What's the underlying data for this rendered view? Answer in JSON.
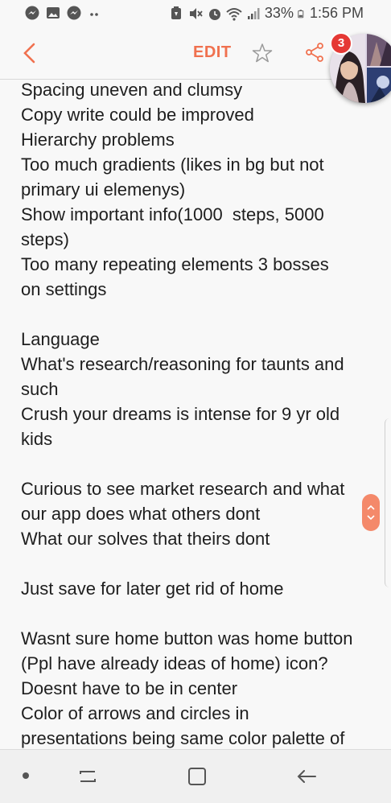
{
  "status_bar": {
    "battery": "33%",
    "time": "1:56 PM"
  },
  "app_bar": {
    "edit_label": "EDIT"
  },
  "chat_head": {
    "badge_count": "3"
  },
  "note": {
    "lines": [
      "Spacing uneven and clumsy",
      "Copy write could be improved",
      "Hierarchy problems",
      "Too much gradients (likes in bg but not",
      "primary ui elemenys)",
      "Show important info(1000  steps, 5000",
      "steps)",
      "Too many repeating elements 3 bosses",
      "on settings",
      "",
      "Language",
      "What's research/reasoning for taunts and",
      "such",
      "Crush your dreams is intense for 9 yr old",
      "kids",
      "",
      "Curious to see market research and what",
      "our app does what others dont",
      "What our solves that theirs dont",
      "",
      "Just save for later get rid of home",
      "",
      "Wasnt sure home button was home button",
      "(Ppl have already ideas of home) icon?",
      "Doesnt have to be in center",
      "Color of arrows and circles in",
      "presentations being same color palette of"
    ]
  },
  "colors": {
    "accent": "#f0714f",
    "badge": "#e53935"
  }
}
